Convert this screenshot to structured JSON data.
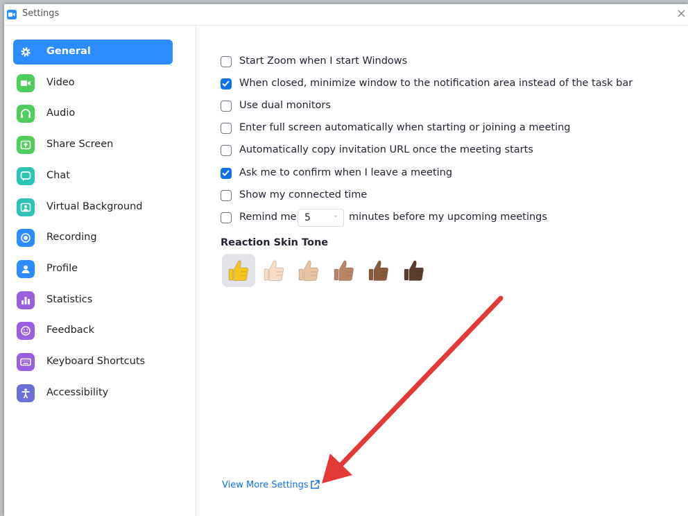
{
  "window": {
    "title": "Settings",
    "close_glyph": "×"
  },
  "sidebar": {
    "items": [
      {
        "label": "General",
        "icon": "gear-icon",
        "color": "#2d8cff",
        "active": true
      },
      {
        "label": "Video",
        "icon": "video-icon",
        "color": "#4fce5d"
      },
      {
        "label": "Audio",
        "icon": "headphones-icon",
        "color": "#4fce5d"
      },
      {
        "label": "Share Screen",
        "icon": "share-screen-icon",
        "color": "#4fce5d"
      },
      {
        "label": "Chat",
        "icon": "chat-icon",
        "color": "#2bc4b5"
      },
      {
        "label": "Virtual Background",
        "icon": "virtual-background-icon",
        "color": "#2bc4b5"
      },
      {
        "label": "Recording",
        "icon": "recording-icon",
        "color": "#2d8cff"
      },
      {
        "label": "Profile",
        "icon": "profile-icon",
        "color": "#2d8cff"
      },
      {
        "label": "Statistics",
        "icon": "statistics-icon",
        "color": "#9a5fe0"
      },
      {
        "label": "Feedback",
        "icon": "feedback-icon",
        "color": "#9a5fe0"
      },
      {
        "label": "Keyboard Shortcuts",
        "icon": "keyboard-icon",
        "color": "#9a5fe0"
      },
      {
        "label": "Accessibility",
        "icon": "accessibility-icon",
        "color": "#6b6fd6"
      }
    ]
  },
  "general": {
    "options": [
      {
        "label": "Start Zoom when I start Windows",
        "checked": false
      },
      {
        "label": "When closed, minimize window to the notification area instead of the task bar",
        "checked": true
      },
      {
        "label": "Use dual monitors",
        "checked": false
      },
      {
        "label": "Enter full screen automatically when starting or joining a meeting",
        "checked": false
      },
      {
        "label": "Automatically copy invitation URL once the meeting starts",
        "checked": false
      },
      {
        "label": "Ask me to confirm when I leave a meeting",
        "checked": true
      },
      {
        "label": "Show my connected time",
        "checked": false
      }
    ],
    "reminder": {
      "label_before": "Remind me",
      "minutes": "5",
      "label_after": "minutes before my upcoming meetings",
      "checked": false
    },
    "reaction_skin_tone": {
      "title": "Reaction Skin Tone",
      "tones": [
        "#f7c520",
        "#f8dcc5",
        "#e7c3a2",
        "#b98567",
        "#8a5a3c",
        "#5a3d2c"
      ],
      "selected_index": 0
    },
    "view_more_link": "View More Settings"
  },
  "colors": {
    "accent": "#2d8cff",
    "checkbox": "#0e71eb",
    "annotation_arrow": "#e53935"
  }
}
